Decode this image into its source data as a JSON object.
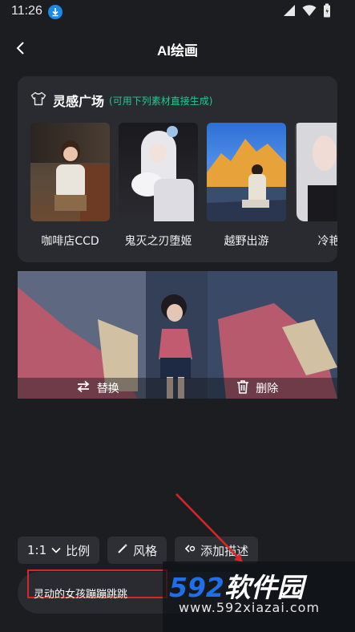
{
  "status_bar": {
    "time": "11:26"
  },
  "header": {
    "title": "AI绘画"
  },
  "inspiration": {
    "title": "灵感广场",
    "subtitle": "(可用下列素材直接生成)",
    "items": [
      {
        "label": "咖啡店CCD"
      },
      {
        "label": "鬼灭之刃堕姬"
      },
      {
        "label": "越野出游"
      },
      {
        "label": "冷艳少"
      }
    ]
  },
  "preview": {
    "replace_label": "替换",
    "delete_label": "删除"
  },
  "options": {
    "ratio_value": "1:1",
    "ratio_label": "比例",
    "style_label": "风格",
    "add_desc_label": "添加描述"
  },
  "prompt": {
    "value": "灵动的女孩蹦蹦跳跳"
  },
  "watermark": {
    "number": "592",
    "brand": "软件园",
    "url": "www.592xiazai.com"
  },
  "colors": {
    "background": "#1c1d21",
    "card": "#2a2b30",
    "accent_green": "#22c98e",
    "highlight_red": "#d6262a",
    "watermark_blue": "#1e6fe8"
  }
}
